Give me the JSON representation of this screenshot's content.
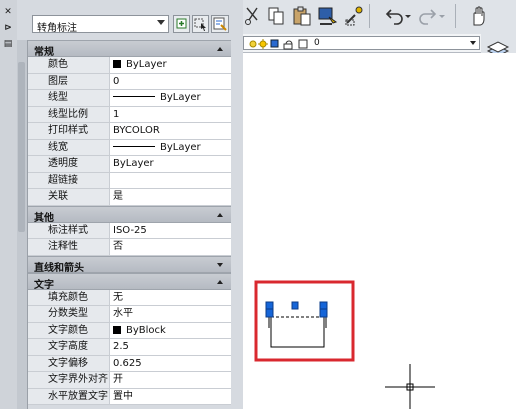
{
  "strip": {
    "close": "✕",
    "pin": "⊳",
    "props": "▤"
  },
  "palette": {
    "selector_value": "转角标注",
    "sections": [
      {
        "title": "常规",
        "expanded": true,
        "rows": [
          {
            "label": "颜色",
            "value": "ByLayer",
            "swatch": true
          },
          {
            "label": "图层",
            "value": "0"
          },
          {
            "label": "线型",
            "value": "ByLayer",
            "line": true
          },
          {
            "label": "线型比例",
            "value": "1"
          },
          {
            "label": "打印样式",
            "value": "BYCOLOR"
          },
          {
            "label": "线宽",
            "value": "ByLayer",
            "line": true
          },
          {
            "label": "透明度",
            "value": "ByLayer"
          },
          {
            "label": "超链接",
            "value": ""
          },
          {
            "label": "关联",
            "value": "是"
          }
        ]
      },
      {
        "title": "其他",
        "expanded": true,
        "rows": [
          {
            "label": "标注样式",
            "value": "ISO-25"
          },
          {
            "label": "注释性",
            "value": "否"
          }
        ]
      },
      {
        "title": "直线和箭头",
        "expanded": false,
        "rows": []
      },
      {
        "title": "文字",
        "expanded": true,
        "rows": [
          {
            "label": "填充颜色",
            "value": "无"
          },
          {
            "label": "分数类型",
            "value": "水平"
          },
          {
            "label": "文字颜色",
            "value": "ByBlock",
            "swatch": true
          },
          {
            "label": "文字高度",
            "value": "2.5"
          },
          {
            "label": "文字偏移",
            "value": "0.625"
          },
          {
            "label": "文字界外对齐",
            "value": "开"
          },
          {
            "label": "水平放置文字",
            "value": "置中"
          }
        ]
      }
    ]
  },
  "layer_bar": {
    "current_layer": "0"
  },
  "colors": {
    "highlight": "#d9282f",
    "grip": "#1565d8"
  }
}
